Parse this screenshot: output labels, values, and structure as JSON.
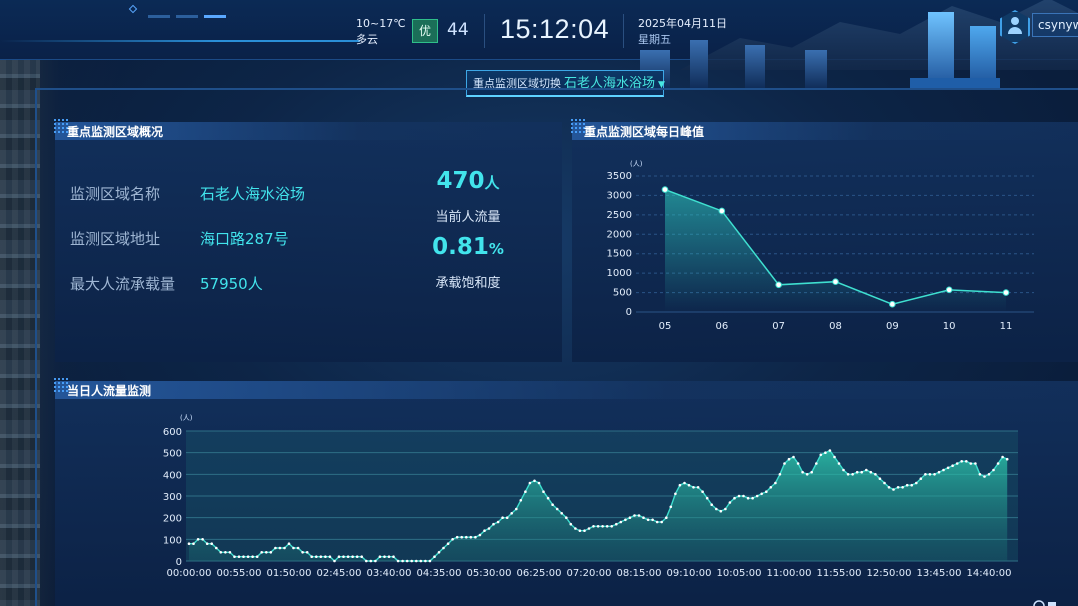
{
  "header": {
    "weather_temp": "10~17℃",
    "weather_desc": "多云",
    "aqi_level": "优",
    "aqi_value": "44",
    "time": "15:12:04",
    "date": "2025年04月11日",
    "weekday": "星期五",
    "username": "csynywn"
  },
  "region_switch": {
    "label": "重点监测区域切换",
    "value": "石老人海水浴场"
  },
  "overview": {
    "title": "重点监测区域概况",
    "rows": [
      {
        "label": "监测区域名称",
        "value": "石老人海水浴场"
      },
      {
        "label": "监测区域地址",
        "value": "海口路287号"
      },
      {
        "label": "最大人流承载量",
        "value": "57950人"
      }
    ],
    "current_flow_value": "470",
    "current_flow_unit": "人",
    "current_flow_label": "当前人流量",
    "saturation_value": "0.81",
    "saturation_unit": "%",
    "saturation_label": "承载饱和度"
  },
  "peak_panel_title": "重点监测区域每日峰值",
  "today_panel_title": "当日人流量监测",
  "chart_data": [
    {
      "type": "line",
      "title": "重点监测区域每日峰值",
      "unit_label": "(人)",
      "categories": [
        "05",
        "06",
        "07",
        "08",
        "09",
        "10",
        "11"
      ],
      "values": [
        3150,
        2600,
        700,
        780,
        200,
        570,
        500
      ],
      "ylim": [
        0,
        3500
      ],
      "yticks": [
        0,
        500,
        1000,
        1500,
        2000,
        2500,
        3000,
        3500
      ],
      "grid": true,
      "color": "#3fe0d0"
    },
    {
      "type": "area",
      "title": "当日人流量监测",
      "unit_label": "(人)",
      "xticks": [
        "00:00:00",
        "00:55:00",
        "01:50:00",
        "02:45:00",
        "03:40:00",
        "04:35:00",
        "05:30:00",
        "06:25:00",
        "07:20:00",
        "08:15:00",
        "09:10:00",
        "10:05:00",
        "11:00:00",
        "11:55:00",
        "12:50:00",
        "13:45:00",
        "14:40:00"
      ],
      "interval_minutes": 5,
      "ylim": [
        0,
        600
      ],
      "yticks": [
        0,
        100,
        200,
        300,
        400,
        500,
        600
      ],
      "grid": true,
      "color": "#3fe0d0",
      "values": [
        80,
        80,
        100,
        100,
        80,
        80,
        60,
        40,
        40,
        40,
        20,
        20,
        20,
        20,
        20,
        20,
        40,
        40,
        40,
        60,
        60,
        60,
        80,
        60,
        60,
        40,
        40,
        20,
        20,
        20,
        20,
        20,
        0,
        20,
        20,
        20,
        20,
        20,
        20,
        0,
        0,
        0,
        20,
        20,
        20,
        20,
        0,
        0,
        0,
        0,
        0,
        0,
        0,
        0,
        20,
        40,
        60,
        80,
        100,
        110,
        110,
        110,
        110,
        110,
        120,
        140,
        150,
        170,
        180,
        200,
        200,
        220,
        240,
        280,
        320,
        360,
        370,
        360,
        320,
        290,
        260,
        240,
        220,
        200,
        170,
        150,
        140,
        140,
        150,
        160,
        160,
        160,
        160,
        160,
        170,
        180,
        190,
        200,
        210,
        210,
        200,
        190,
        190,
        180,
        180,
        200,
        250,
        310,
        350,
        360,
        350,
        340,
        340,
        320,
        290,
        260,
        240,
        230,
        240,
        270,
        290,
        300,
        300,
        290,
        290,
        300,
        310,
        320,
        340,
        360,
        400,
        450,
        470,
        480,
        450,
        410,
        400,
        410,
        450,
        490,
        500,
        510,
        480,
        450,
        420,
        400,
        400,
        410,
        410,
        420,
        410,
        400,
        380,
        360,
        340,
        330,
        340,
        340,
        350,
        350,
        360,
        380,
        400,
        400,
        400,
        410,
        420,
        430,
        440,
        450,
        460,
        460,
        450,
        450,
        400,
        390,
        400,
        420,
        450,
        480,
        470
      ]
    }
  ]
}
